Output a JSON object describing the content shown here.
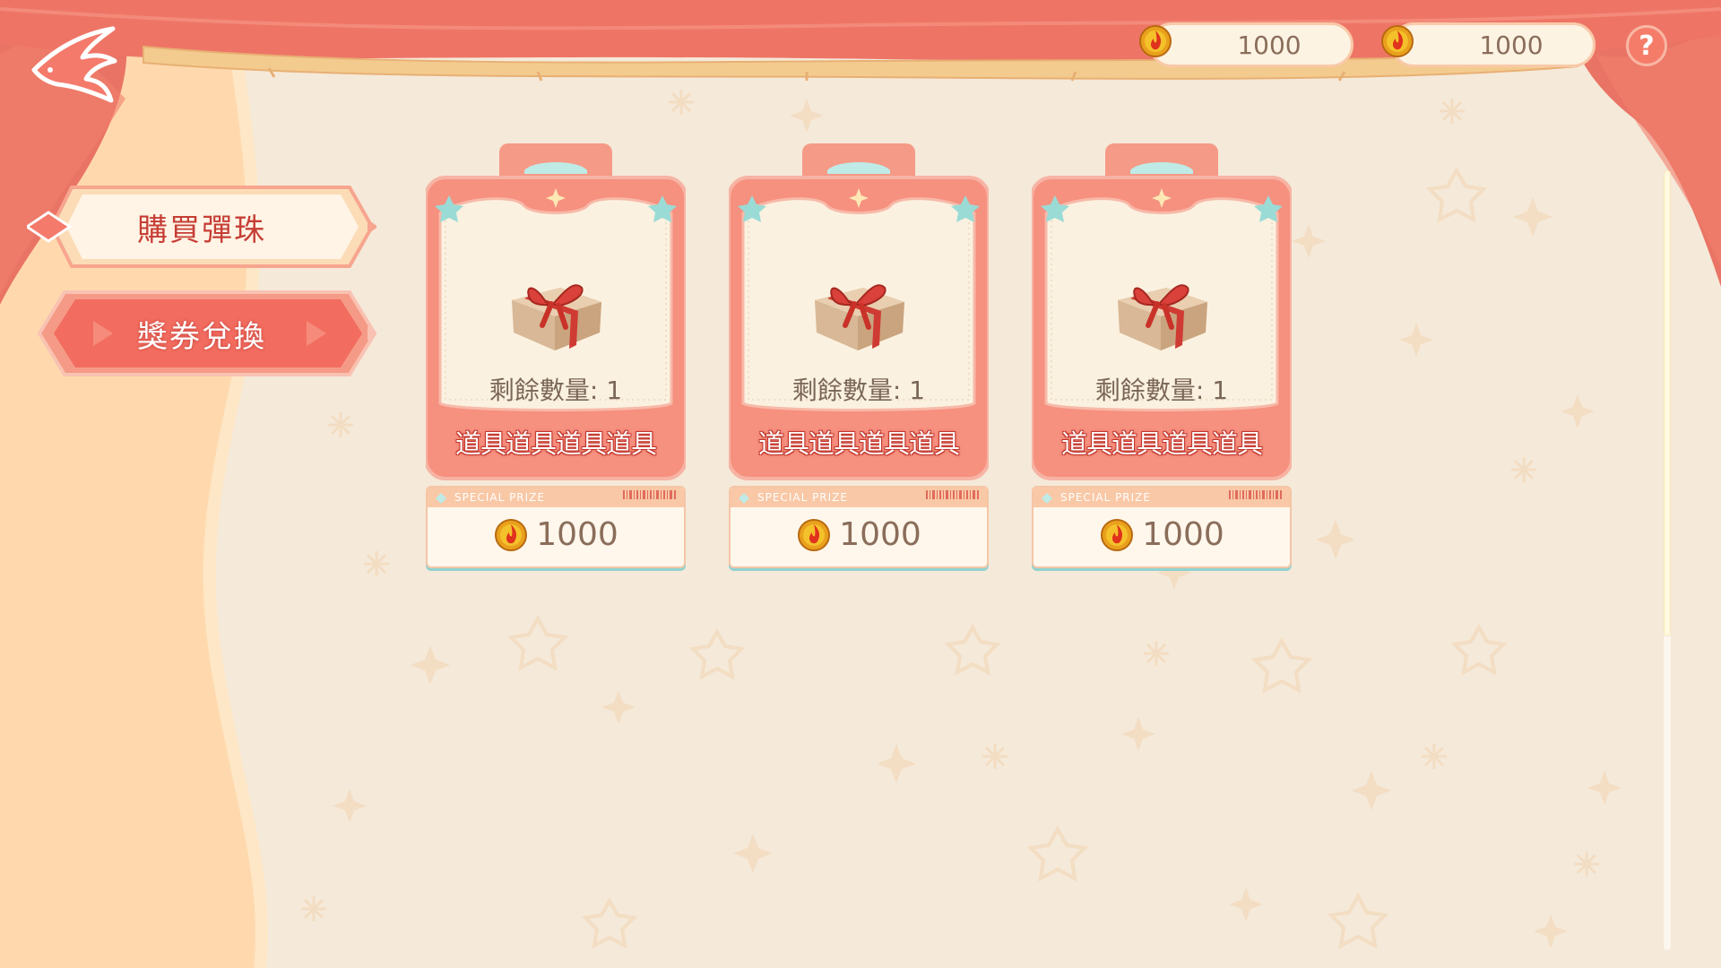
{
  "currency": {
    "primary": "1000",
    "secondary": "1000"
  },
  "help_label": "?",
  "tabs": [
    {
      "label": "購買彈珠",
      "active": false
    },
    {
      "label": "獎券兌換",
      "active": true
    }
  ],
  "cards": [
    {
      "quantity": "剩餘數量: 1",
      "name": "道具道具道具道具",
      "badge": "SPECIAL PRIZE",
      "price": "1000"
    },
    {
      "quantity": "剩餘數量: 1",
      "name": "道具道具道具道具",
      "badge": "SPECIAL PRIZE",
      "price": "1000"
    },
    {
      "quantity": "剩餘數量: 1",
      "name": "道具道具道具道具",
      "badge": "SPECIAL PRIZE",
      "price": "1000"
    }
  ],
  "colors": {
    "curtain": "#f0786a",
    "accent": "#f57c69",
    "card_frame": "#f7a08f",
    "background": "#f5e9d9"
  },
  "icons": {
    "back": "swallow-back-icon",
    "coin": "flame-coin-icon",
    "gift": "gift-box-icon"
  }
}
